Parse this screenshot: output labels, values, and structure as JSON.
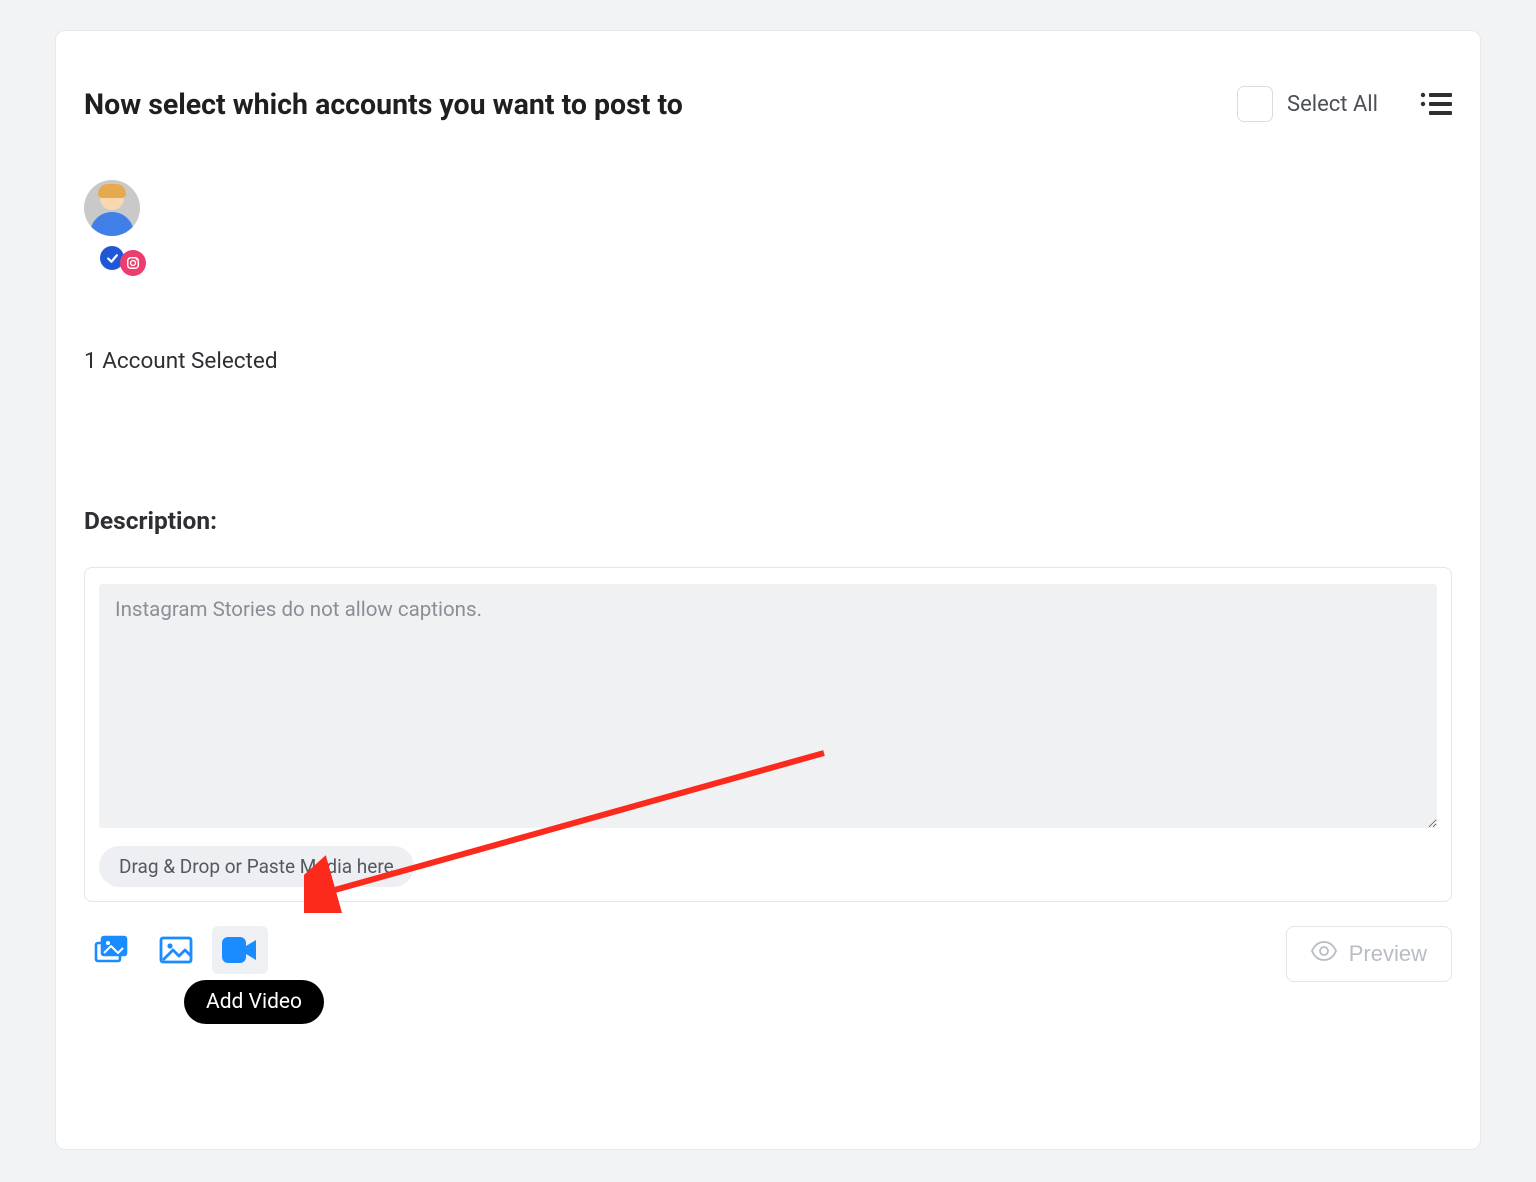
{
  "header": {
    "title": "Now select which accounts you want to post to",
    "select_all_label": "Select All"
  },
  "accounts": {
    "selected_count_label": "1 Account Selected"
  },
  "description": {
    "label": "Description:",
    "placeholder": "Instagram Stories do not allow captions.",
    "drag_hint": "Drag & Drop or Paste Media here"
  },
  "media_buttons": {
    "library_icon": "media-library-icon",
    "image_icon": "image-icon",
    "video_icon": "video-icon",
    "video_tooltip": "Add Video"
  },
  "preview": {
    "label": "Preview"
  },
  "colors": {
    "accent_blue": "#1a8cff",
    "check_blue": "#1f57d6",
    "ig_pink": "#eb3d6e",
    "arrow_red": "#fb2a1c"
  }
}
